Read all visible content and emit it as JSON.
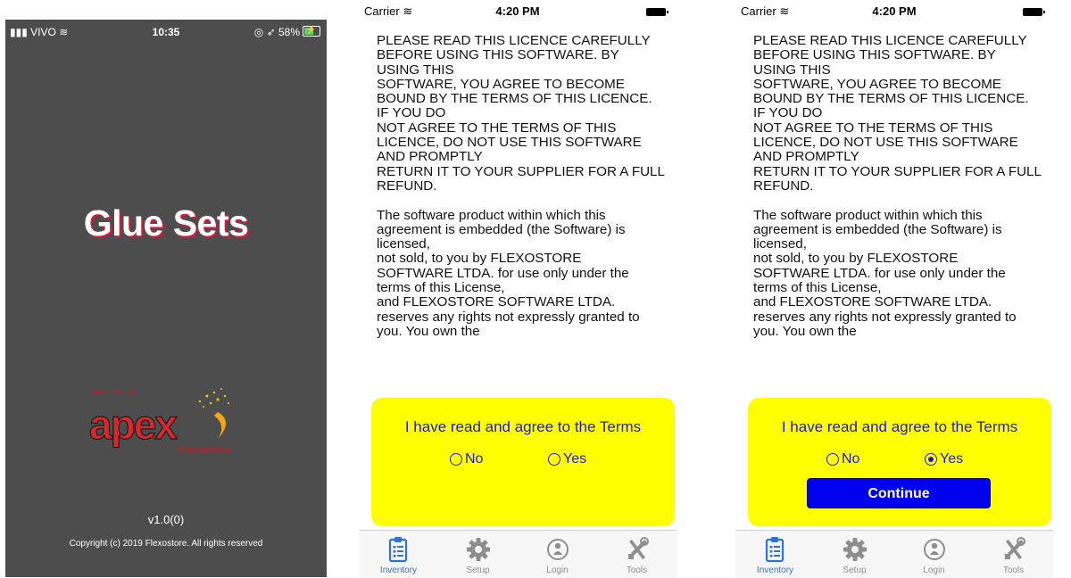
{
  "splash": {
    "status": {
      "carrier": "VIVO",
      "time": "10:35",
      "battery": "58%"
    },
    "title": "Glue Sets",
    "logo": {
      "brand": "apex",
      "sub": "international",
      "tagline": "Sponsored by"
    },
    "version": "v1.0(0)",
    "copyright": "Copyright (c) 2019 Flexostore. All rights reserved"
  },
  "licence_screen": {
    "status": {
      "carrier": "Carrier",
      "time": "4:20 PM"
    },
    "licence_text": "PLEASE READ THIS LICENCE CAREFULLY\nBEFORE USING THIS SOFTWARE.  BY\nUSING THIS\nSOFTWARE, YOU AGREE TO BECOME\nBOUND BY THE TERMS OF THIS LICENCE.\nIF YOU DO\nNOT AGREE TO THE TERMS OF THIS\nLICENCE, DO NOT USE THIS SOFTWARE\nAND PROMPTLY\nRETURN IT TO YOUR SUPPLIER FOR A FULL\nREFUND.\n\nThe software product within which this\nagreement is embedded (the Software) is\nlicensed,\nnot sold, to you by FLEXOSTORE\nSOFTWARE LTDA. for use only under the\nterms of this License,\nand FLEXOSTORE SOFTWARE LTDA.\nreserves any rights not expressly granted to\nyou.  You own the",
    "agree_question": "I have read and agree to the Terms",
    "options": {
      "no": "No",
      "yes": "Yes"
    },
    "continue_label": "Continue",
    "tabs": [
      "Inventory",
      "Setup",
      "Login",
      "Tools"
    ]
  },
  "screen_states": [
    {
      "selected": "none",
      "continue_visible": false
    },
    {
      "selected": "yes",
      "continue_visible": true
    }
  ],
  "colors": {
    "splash_bg": "#4d4d4d",
    "title_shadow": "#d21d3c",
    "agree_bg": "#ffff00",
    "agree_text": "#1a1ad4",
    "continue_bg": "#0000ee",
    "tab_active": "#2b74d6",
    "tab_inactive": "#8e8e8e"
  },
  "icons": [
    "wifi-icon",
    "signal-icon",
    "battery-icon",
    "clipboard-icon",
    "gear-icon",
    "person-icon",
    "tools-icon"
  ]
}
